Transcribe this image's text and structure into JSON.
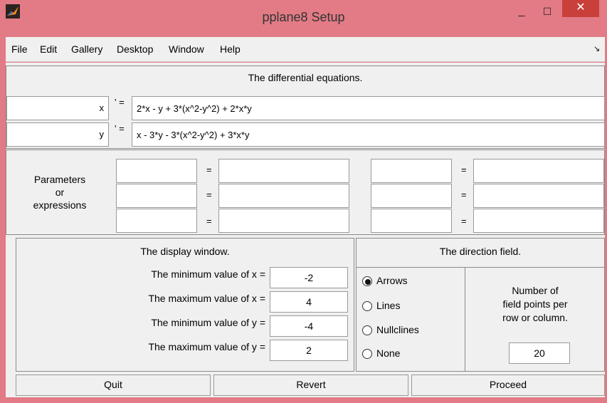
{
  "window": {
    "title": "pplane8 Setup",
    "minimize": "_",
    "maximize": "☐",
    "close": "✕"
  },
  "menu": [
    "File",
    "Edit",
    "Gallery",
    "Desktop",
    "Window",
    "Help"
  ],
  "menu_arrow": "↘",
  "equations": {
    "heading": "The differential equations.",
    "rows": [
      {
        "var": "x",
        "prime_eq": "' =",
        "expr": "2*x - y + 3*(x^2-y^2) + 2*x*y"
      },
      {
        "var": "y",
        "prime_eq": "' =",
        "expr": "x - 3*y - 3*(x^2-y^2) + 3*x*y"
      }
    ]
  },
  "parameters": {
    "label_line1": "Parameters",
    "label_line2": "or",
    "label_line3": "expressions",
    "eq": "="
  },
  "display": {
    "heading": "The display window.",
    "rows": [
      {
        "label": "The minimum value of x =",
        "value": "-2"
      },
      {
        "label": "The maximum value of x =",
        "value": "4"
      },
      {
        "label": "The minimum value of y =",
        "value": "-4"
      },
      {
        "label": "The maximum value of y =",
        "value": "2"
      }
    ]
  },
  "direction": {
    "heading": "The direction field.",
    "options": [
      "Arrows",
      "Lines",
      "Nullclines",
      "None"
    ],
    "selected": "Arrows",
    "points_label_line1": "Number of",
    "points_label_line2": "field points per",
    "points_label_line3": "row or column.",
    "points_value": "20"
  },
  "buttons": {
    "quit": "Quit",
    "revert": "Revert",
    "proceed": "Proceed"
  },
  "colors": {
    "titlebar": "#e27b85",
    "close": "#c9403a",
    "panel": "#f0f0f0"
  }
}
